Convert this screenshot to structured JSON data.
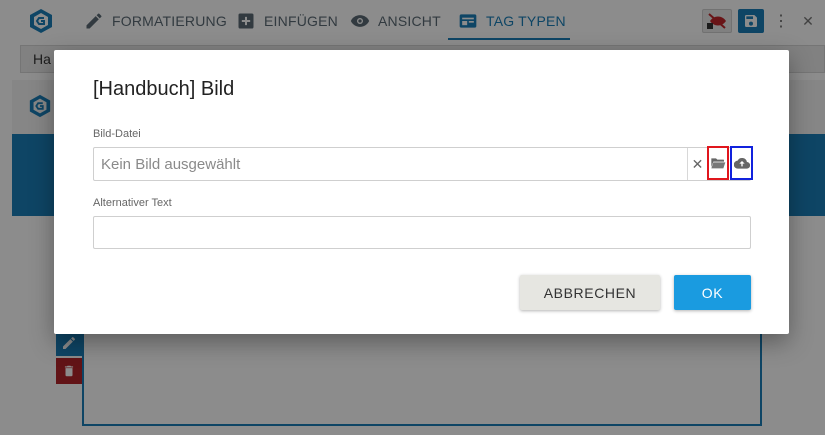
{
  "toolbar": {
    "items": [
      {
        "label": "FORMATIERUNG",
        "icon": "pencil-icon"
      },
      {
        "label": "EINFÜGEN",
        "icon": "plus-box-icon"
      },
      {
        "label": "ANSICHT",
        "icon": "eye-icon"
      },
      {
        "label": "TAG TYPEN",
        "icon": "tag-types-icon"
      }
    ],
    "active_item": "TAG TYPEN",
    "right_icons": [
      "visibility-off-lock-icon",
      "save-icon",
      "more-vert-icon",
      "close-icon"
    ],
    "close_glyph": "✕",
    "menu_glyph": "⋮"
  },
  "tab": {
    "label": "Ha"
  },
  "dialog": {
    "title": "[Handbuch] Bild",
    "file_field": {
      "label": "Bild-Datei",
      "placeholder": "Kein Bild ausgewählt",
      "value": "",
      "clear_glyph": "✕",
      "browse_icon": "folder-open-icon",
      "upload_icon": "cloud-upload-icon"
    },
    "alt_field": {
      "label": "Alternativer Text",
      "value": ""
    },
    "cancel_label": "ABBRECHEN",
    "ok_label": "OK"
  },
  "colors": {
    "accent": "#1a7fb8",
    "ok_button": "#1a9be0",
    "cancel_button": "#e6e6e1",
    "delete_tool": "#b3262b",
    "highlight_red": "#e0161d",
    "highlight_blue": "#1122dd"
  }
}
